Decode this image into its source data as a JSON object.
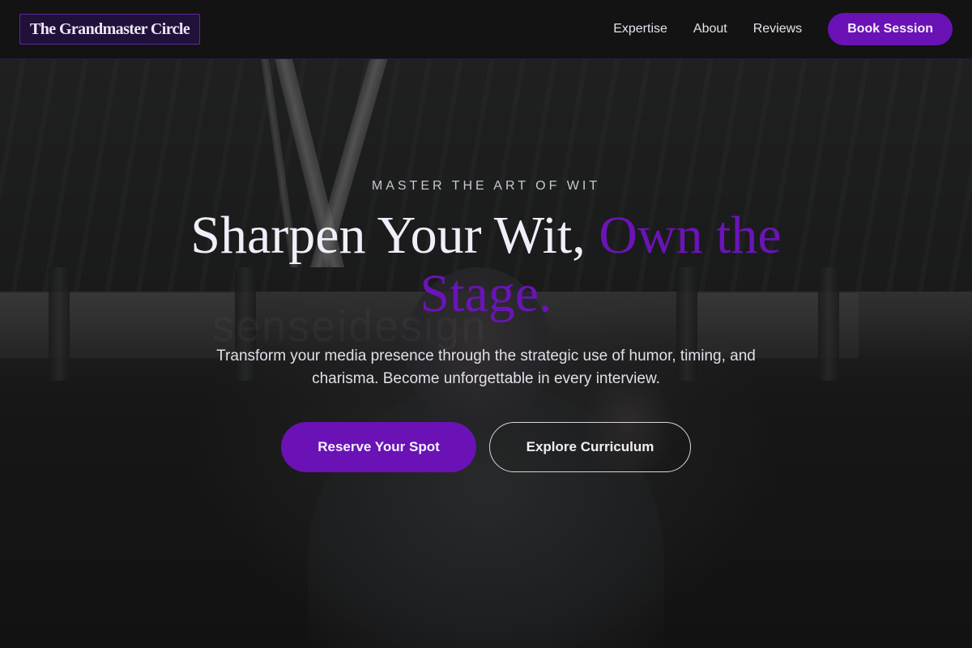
{
  "header": {
    "brand": "The Grandmaster Circle",
    "nav": [
      {
        "label": "Expertise"
      },
      {
        "label": "About"
      },
      {
        "label": "Reviews"
      }
    ],
    "cta_label": "Book Session"
  },
  "hero": {
    "eyebrow": "MASTER THE ART OF WIT",
    "headline_main": "Sharpen Your Wit, ",
    "headline_accent": "Own the Stage.",
    "subtitle": "Transform your media presence through the strategic use of humor, timing, and charisma. Become unforgettable in every interview.",
    "primary_button": "Reserve Your Spot",
    "secondary_button": "Explore Curriculum",
    "watermark": "senseidesign"
  },
  "colors": {
    "accent": "#6a12b5",
    "background": "#131313",
    "text": "#f1eefa"
  }
}
